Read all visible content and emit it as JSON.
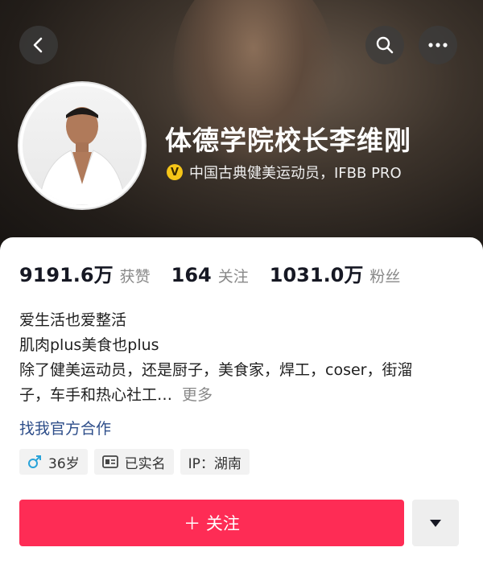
{
  "header": {
    "display_name": "体德学院校长李维刚",
    "verification": "中国古典健美运动员，IFBB PRO",
    "verify_badge": "V"
  },
  "nav": {
    "back_icon": "chevron-left-icon",
    "search_icon": "search-icon",
    "more_icon": "more-horizontal-icon"
  },
  "stats": [
    {
      "value": "9191.6万",
      "label": "获赞"
    },
    {
      "value": "164",
      "label": "关注"
    },
    {
      "value": "1031.0万",
      "label": "粉丝"
    }
  ],
  "bio": {
    "lines": [
      "爱生活也爱整活",
      "肌肉plus美食也plus",
      "除了健美运动员，还是厨子，美食家，焊工，coser，街溜",
      "子，车手和热心社工…"
    ],
    "more": "更多"
  },
  "cooperation_link": "找我官方合作",
  "tags": {
    "age": "36岁",
    "realname": "已实名",
    "ip": "IP：湖南"
  },
  "actions": {
    "follow_label": "＋ 关注"
  },
  "colors": {
    "accent": "#fe2c55",
    "link": "#2e4e8a",
    "verify_gold": "#f5c518"
  }
}
